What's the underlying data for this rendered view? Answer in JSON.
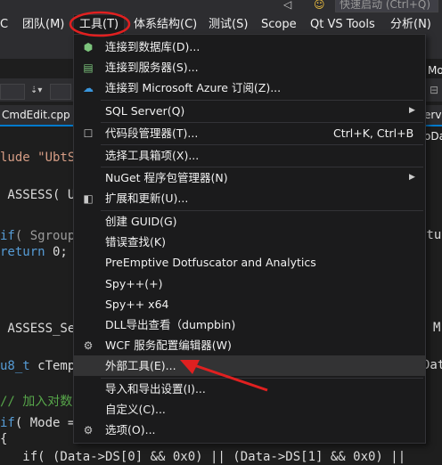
{
  "top": {
    "quick_launch": "快速启动 (Ctrl+Q)",
    "glyph_left": "◁",
    "glyph_face": "☺"
  },
  "menubar": [
    {
      "label": "C"
    },
    {
      "label": "团队(M)"
    },
    {
      "label": "工具(T)"
    },
    {
      "label": "体系结构(C)"
    },
    {
      "label": "测试(S)"
    },
    {
      "label": "Scope"
    },
    {
      "label": "Qt VS Tools"
    },
    {
      "label": "分析(N)"
    }
  ],
  "tabs": {
    "active": "CmdEdit.cpp"
  },
  "right_texts": {
    "mos": "Mos",
    "ervo": "ervo",
    "oda": "oDa",
    "etu": "etu",
    "m": "M",
    "dat": "Dat"
  },
  "code": {
    "l1": "lude \"UbtS",
    "l2": " ASSESS( U",
    "l3a": "if",
    "l3b": "( Sgroup",
    "l4a": "return",
    "l4b": " 0;",
    "l5": " ASSESS_Se",
    "l6a": "u8_t",
    "l6b": " cTemp",
    "l7": "// 加入对数",
    "l8a": "if",
    "l8b": "( Mode =",
    "l9": "{",
    "l10": "   if( (Data->DS[0] && 0x0) || (Data->DS[1] && 0x0) ||"
  },
  "menu": {
    "items": [
      {
        "icon": "database-connect-icon",
        "glyph": "⬢",
        "label": "连接到数据库(D)..."
      },
      {
        "icon": "server-connect-icon",
        "glyph": "▤",
        "label": "连接到服务器(S)..."
      },
      {
        "icon": "azure-cloud-icon",
        "glyph": "☁",
        "label": "连接到 Microsoft Azure 订阅(Z)..."
      },
      {
        "label": "SQL Server(Q)",
        "arrow": "▶"
      },
      {
        "icon": "code-snippet-icon",
        "glyph": "☐",
        "label": "代码段管理器(T)...",
        "shortcut": "Ctrl+K, Ctrl+B"
      },
      {
        "label": "选择工具箱项(X)..."
      },
      {
        "label": "NuGet 程序包管理器(N)",
        "arrow": "▶"
      },
      {
        "icon": "extensions-icon",
        "glyph": "◧",
        "label": "扩展和更新(U)..."
      },
      {
        "label": "创建 GUID(G)"
      },
      {
        "label": "错误查找(K)"
      },
      {
        "label": "PreEmptive Dotfuscator and Analytics"
      },
      {
        "label": "Spy++(+)"
      },
      {
        "label": "Spy++ x64"
      },
      {
        "label": "DLL导出查看（dumpbin)"
      },
      {
        "icon": "wcf-config-icon",
        "glyph": "⚙",
        "label": "WCF 服务配置编辑器(W)"
      },
      {
        "label": "外部工具(E)...",
        "highlighted": true
      },
      {
        "label": "导入和导出设置(I)..."
      },
      {
        "label": "自定义(C)..."
      },
      {
        "icon": "gear-icon",
        "glyph": "⚙",
        "label": "选项(O)..."
      }
    ]
  },
  "colors": {
    "annotation": "#e02020",
    "accent": "#007acc",
    "menu_bg": "#1b1b1c"
  }
}
